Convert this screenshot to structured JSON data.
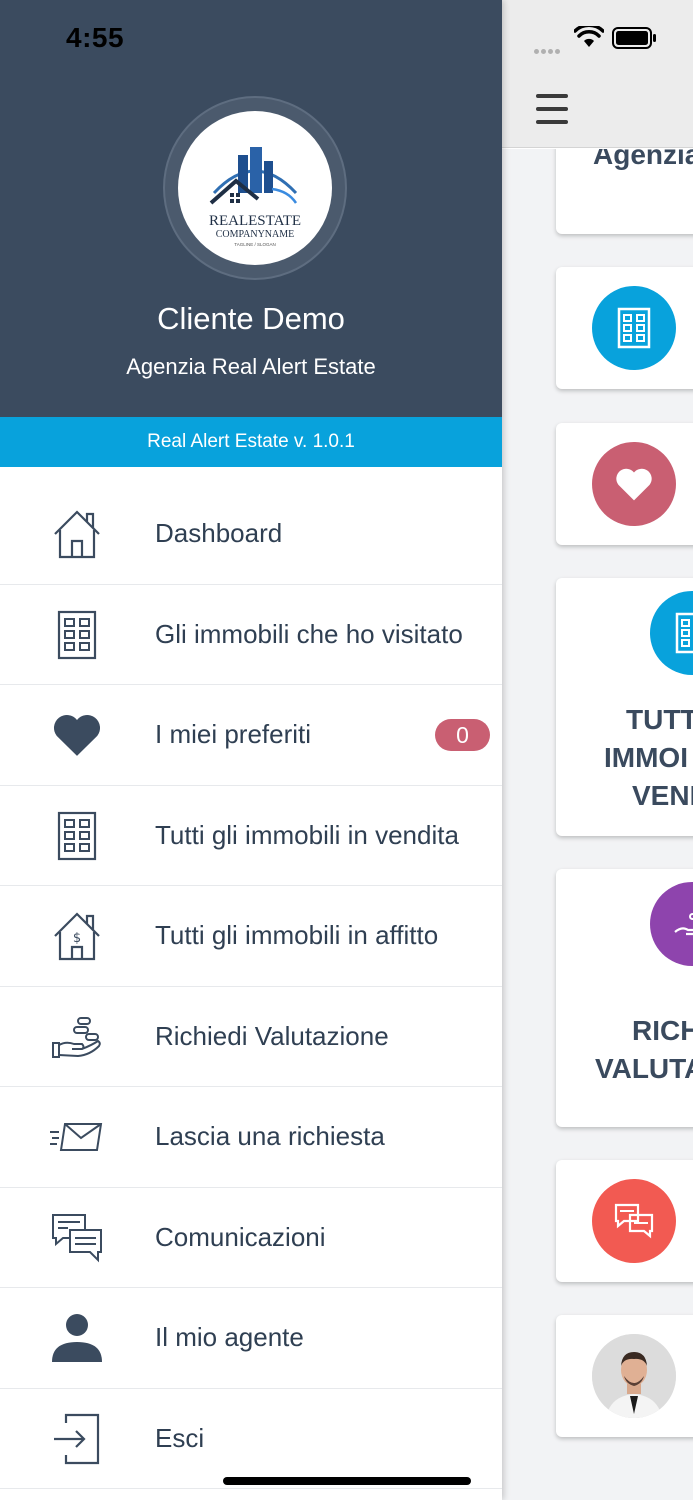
{
  "status_bar": {
    "time": "4:55"
  },
  "drawer": {
    "user_name": "Cliente Demo",
    "agency_name": "Agenzia Real Alert Estate",
    "version": "Real Alert Estate v. 1.0.1",
    "logo": {
      "brand": "REALESTATE",
      "company": "COMPANYNAME",
      "tagline": "TAGLINE / SLOGAN"
    },
    "menu": [
      {
        "label": "Dashboard",
        "icon": "house-outline-icon"
      },
      {
        "label": "Gli immobili che ho visitato",
        "icon": "building-icon"
      },
      {
        "label": "I miei preferiti",
        "icon": "heart-icon",
        "badge": "0"
      },
      {
        "label": "Tutti gli immobili in vendita",
        "icon": "building-icon"
      },
      {
        "label": "Tutti gli immobili in affitto",
        "icon": "house-dollar-icon"
      },
      {
        "label": "Richiedi Valutazione",
        "icon": "hand-coins-icon"
      },
      {
        "label": "Lascia una richiesta",
        "icon": "envelope-fast-icon"
      },
      {
        "label": "Comunicazioni",
        "icon": "chat-bubbles-icon"
      },
      {
        "label": "Il mio agente",
        "icon": "person-icon"
      },
      {
        "label": "Esci",
        "icon": "logout-icon"
      }
    ]
  },
  "background": {
    "card_agency_partial": "Agenzia",
    "card_sale_lines": [
      "TUTT",
      "IMMOI",
      "VENI"
    ],
    "card_valuation_lines": [
      "RICH",
      "VALUTA"
    ],
    "colors": {
      "header": "#3b4b5f",
      "accent_blue": "#08a2dc",
      "heart_red": "#c95f72",
      "purple": "#8e44ad",
      "chat_red": "#f25a52"
    }
  }
}
